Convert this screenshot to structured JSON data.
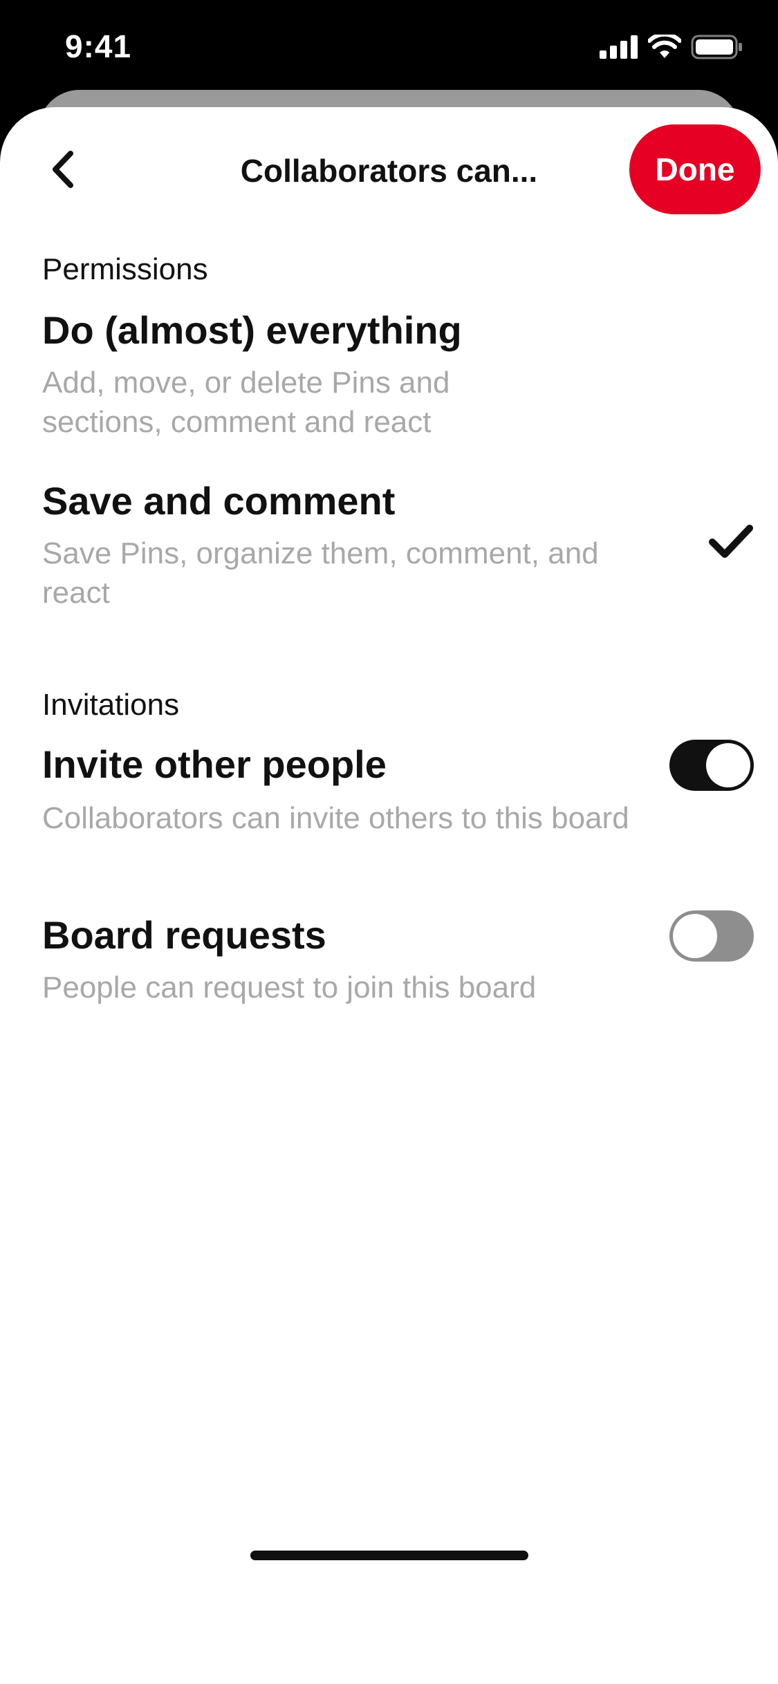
{
  "status_bar": {
    "time": "9:41",
    "icons": [
      "signal-icon",
      "wifi-icon",
      "battery-icon"
    ]
  },
  "header": {
    "back_icon": "chevron-left-icon",
    "title": "Collaborators can...",
    "done_label": "Done"
  },
  "permissions": {
    "label": "Permissions",
    "options": [
      {
        "title": "Do (almost) everything",
        "description": "Add, move, or delete Pins and sections, comment and react",
        "selected": false
      },
      {
        "title": "Save and comment",
        "description": "Save Pins, organize them, comment, and react",
        "selected": true
      }
    ]
  },
  "invitations": {
    "label": "Invitations",
    "options": [
      {
        "title": "Invite other people",
        "description": "Collaborators can invite others to this board",
        "enabled": true
      },
      {
        "title": "Board requests",
        "description": "People can request to join this board",
        "enabled": false
      }
    ]
  },
  "colors": {
    "accent": "#e60023",
    "text": "#111111",
    "muted": "#a8a8a8"
  }
}
